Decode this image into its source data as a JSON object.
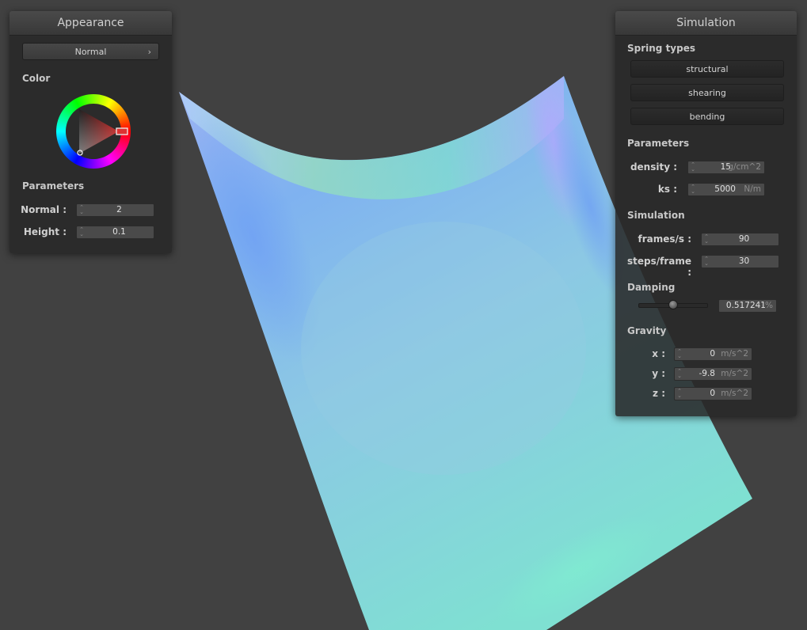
{
  "appearance": {
    "title": "Appearance",
    "shader_select": "Normal",
    "color_label": "Color",
    "parameters_label": "Parameters",
    "normal_label": "Normal :",
    "normal_value": "2",
    "height_label": "Height :",
    "height_value": "0.1",
    "selected_color": "#c8201e"
  },
  "simulation": {
    "title": "Simulation",
    "spring_types_label": "Spring types",
    "spring_types": [
      "structural",
      "shearing",
      "bending"
    ],
    "parameters_label": "Parameters",
    "density_label": "density :",
    "density_value": "15",
    "density_unit": "g/cm^2",
    "ks_label": "ks :",
    "ks_value": "5000",
    "ks_unit": "N/m",
    "simulation_label": "Simulation",
    "fps_label": "frames/s :",
    "fps_value": "90",
    "steps_label": "steps/frame :",
    "steps_value": "30",
    "damping_label": "Damping",
    "damping_fraction": 0.517241,
    "damping_value": "0.517241",
    "damping_unit": "%",
    "gravity_label": "Gravity",
    "gx_label": "x :",
    "gx_value": "0",
    "gy_label": "y :",
    "gy_value": "-9.8",
    "gz_label": "z :",
    "gz_value": "0",
    "gravity_unit": "m/s^2"
  },
  "colors": {
    "background": "#414141",
    "cloth_top": "#8fb6f2",
    "cloth_bottom": "#7fe0d2"
  }
}
